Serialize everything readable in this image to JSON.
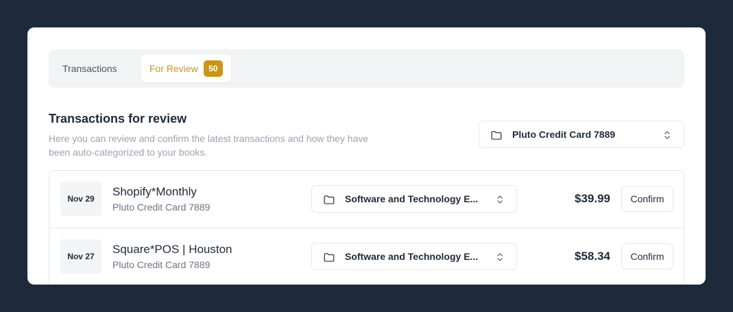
{
  "tabs": [
    {
      "label": "Transactions",
      "active": false
    },
    {
      "label": "For Review",
      "active": true,
      "badge": "50"
    }
  ],
  "section": {
    "title": "Transactions for review",
    "description": "Here you can review and confirm the latest transactions and how they have been auto-categorized to your books."
  },
  "account_select": {
    "value": "Pluto Credit Card 7889",
    "icon": "folder-icon"
  },
  "transactions": [
    {
      "date": "Nov 29",
      "merchant": "Shopify*Monthly",
      "account": "Pluto Credit Card 7889",
      "category": "Software and Technology E...",
      "amount": "$39.99",
      "confirm_label": "Confirm"
    },
    {
      "date": "Nov 27",
      "merchant": "Square*POS | Houston",
      "account": "Pluto Credit Card 7889",
      "category": "Software and Technology E...",
      "amount": "$58.34",
      "confirm_label": "Confirm"
    }
  ],
  "colors": {
    "frame_bg": "#1e293b",
    "accent": "#c9961a",
    "border": "#e5e7eb"
  }
}
